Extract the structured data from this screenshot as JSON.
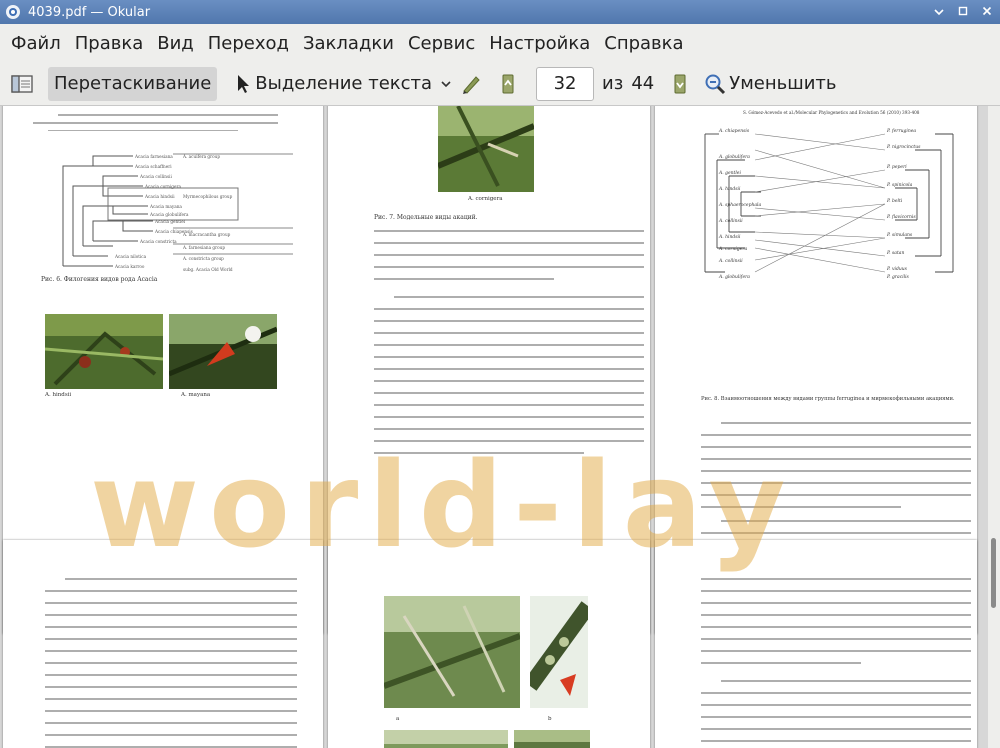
{
  "window": {
    "title": "4039.pdf — Okular",
    "controls": [
      "minimize",
      "maximize",
      "close"
    ]
  },
  "menu": [
    "Файл",
    "Правка",
    "Вид",
    "Переход",
    "Закладки",
    "Сервис",
    "Настройка",
    "Справка"
  ],
  "toolbar": {
    "drag_label": "Перетаскивание",
    "select_label": "Выделение текста",
    "current_page": "32",
    "of_label": "из",
    "total_pages": "44",
    "zoom_out_label": "Уменьшить"
  },
  "pages": {
    "p1": {
      "fig_caption": "Рис. 6. Филогения видов рода Acacia",
      "photo_a": "A. hindsii",
      "photo_b": "A. mayana",
      "groups": [
        "A. acuifera group",
        "Myrmecophilous group",
        "A. macracantha group",
        "A. farnesiana group",
        "A. constricta group",
        "subg. Acacia Old World"
      ]
    },
    "p2": {
      "photo": "A. cornigera",
      "fig_caption": "Рис. 7. Модельные виды акаций."
    },
    "p3": {
      "header": "S. Gómez-Acevedo et al./Molecular Phylogenetics and Evolution 56 (2010) 393-408",
      "fig_caption": "Рис. 8. Взаимоотношения между видами группы ferruginea и мирмекофильными акациями.",
      "left_taxa": [
        "A. chiapensis",
        "A. globulifera",
        "A. gentlei",
        "A. hindsii",
        "A. sphaerocephala",
        "A. collinsii",
        "A. hindsii",
        "A. cornigera",
        "A. collinsii",
        "A. globulifera"
      ],
      "right_taxa": [
        "P. ferruginea",
        "P. nigrocinctus",
        "P. peperi",
        "P. spinicola",
        "P. belti",
        "P. flavicornis",
        "P. simulans",
        "P. satan",
        "P. viduus",
        "P. gracilis"
      ]
    },
    "p5": {
      "photo_a": "a",
      "photo_b": "b"
    }
  },
  "watermark": "world-lay"
}
